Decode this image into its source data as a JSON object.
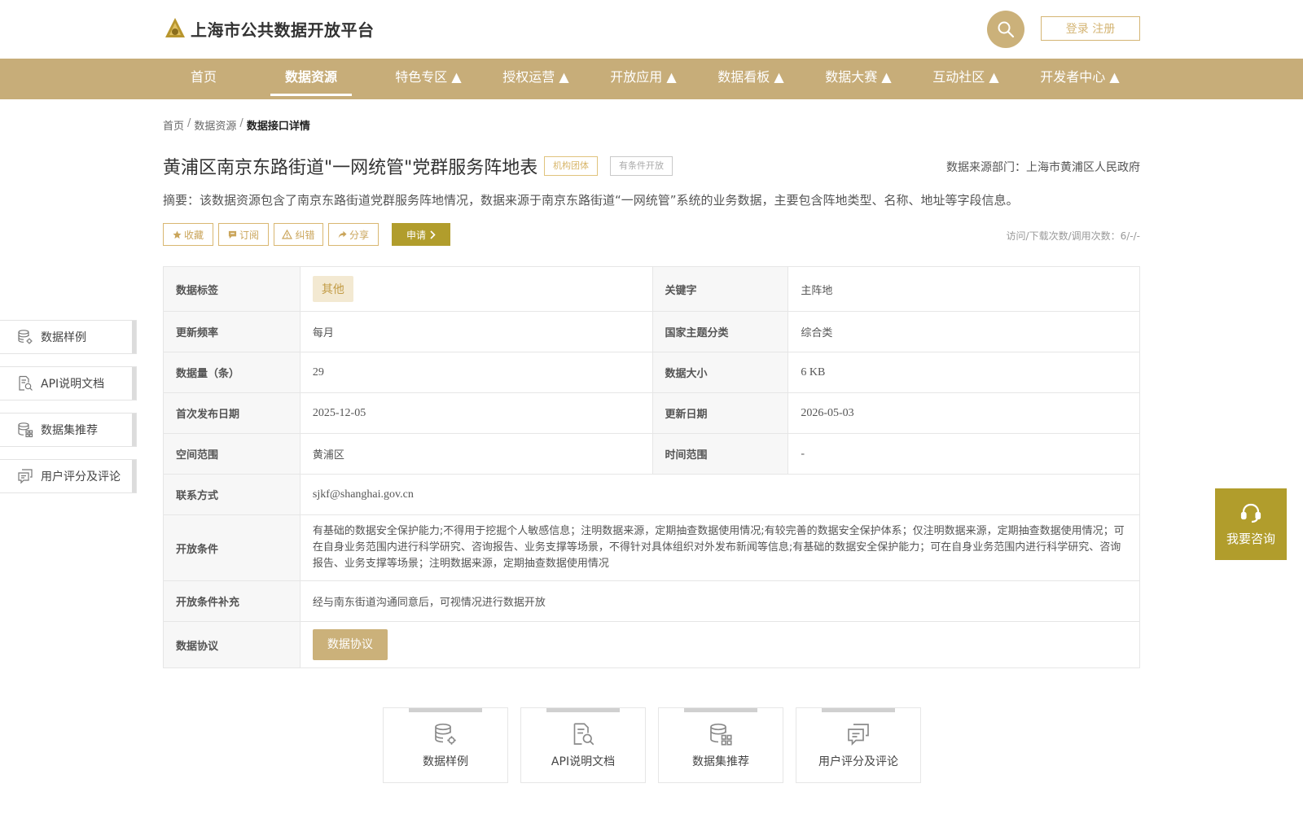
{
  "header": {
    "site_title": "上海市公共数据开放平台",
    "login_label": "登录 注册",
    "colors": {
      "brand": "#c7ad79",
      "accent": "#b19d2c"
    }
  },
  "nav": {
    "items": [
      {
        "label": "首页"
      },
      {
        "label": "数据资源"
      },
      {
        "label": "特色专区 ▲"
      },
      {
        "label": "授权运营 ▲"
      },
      {
        "label": "开放应用 ▲"
      },
      {
        "label": "数据看板 ▲"
      },
      {
        "label": "数据大赛 ▲"
      },
      {
        "label": "互动社区 ▲"
      },
      {
        "label": "开发者中心 ▲"
      }
    ],
    "active": "数据资源"
  },
  "breadcrumb": {
    "home": "首页",
    "sep": "/",
    "section": "数据资源",
    "current": "数据接口详情"
  },
  "dataset": {
    "title": "黄浦区南京东路街道\"一网统管\"党群服务阵地表",
    "tag_org": "机构团体",
    "tag_open": "有条件开放",
    "source": "数据来源部门：上海市黄浦区人民政府",
    "summary": "摘要：该数据资源包含了南京东路街道党群服务阵地情况，数据来源于南京东路街道“一网统管”系统的业务数据，主要包含阵地类型、名称、地址等字段信息。",
    "visits": "访问/下载次数/调用次数：6/-/-"
  },
  "actions": {
    "favorite": "收藏",
    "subscribe": "订阅",
    "correct": "纠错",
    "share": "分享",
    "apply": "申请"
  },
  "details": {
    "tag_label": "数据标签",
    "tag_value": "其他",
    "keyword_label": "关键字",
    "keyword_value": "主阵地",
    "freq_label": "更新频率",
    "freq_value": "每月",
    "theme_label": "国家主题分类",
    "theme_value": "综合类",
    "count_label": "数据量（条）",
    "count_value": "29",
    "size_label": "数据大小",
    "size_value": "6 KB",
    "pub_label": "首次发布日期",
    "pub_value": "2025-12-05",
    "upd_label": "更新日期",
    "upd_value": "2026-05-03",
    "space_label": "空间范围",
    "space_value": "黄浦区",
    "time_label": "时间范围",
    "time_value": "-",
    "contact_label": "联系方式",
    "contact_value": "sjkf@shanghai.gov.cn",
    "cond_label": "开放条件",
    "cond_value": "有基础的数据安全保护能力;不得用于挖掘个人敏感信息；注明数据来源，定期抽查数据使用情况;有较完善的数据安全保护体系；仅注明数据来源，定期抽查数据使用情况；可在自身业务范围内进行科学研究、咨询报告、业务支撑等场景，不得针对具体组织对外发布新闻等信息;有基础的数据安全保护能力；可在自身业务范围内进行科学研究、咨询报告、业务支撑等场景；注明数据来源，定期抽查数据使用情况",
    "cond_sup_label": "开放条件补充",
    "cond_sup_value": "经与南东街道沟通同意后，可视情况进行数据开放",
    "agreement_label": "数据协议",
    "agreement_button": "数据协议"
  },
  "side_menu": [
    {
      "label": "数据样例",
      "icon": "database-gear-icon"
    },
    {
      "label": "API说明文档",
      "icon": "document-search-icon"
    },
    {
      "label": "数据集推荐",
      "icon": "database-grid-icon"
    },
    {
      "label": "用户评分及评论",
      "icon": "comments-icon"
    }
  ],
  "consult": {
    "label": "我要咨询",
    "icon": "headset-icon"
  },
  "cards": [
    {
      "label": "数据样例",
      "icon": "database-gear-icon"
    },
    {
      "label": "API说明文档",
      "icon": "document-search-icon"
    },
    {
      "label": "数据集推荐",
      "icon": "database-grid-icon"
    },
    {
      "label": "用户评分及评论",
      "icon": "comments-icon"
    }
  ]
}
